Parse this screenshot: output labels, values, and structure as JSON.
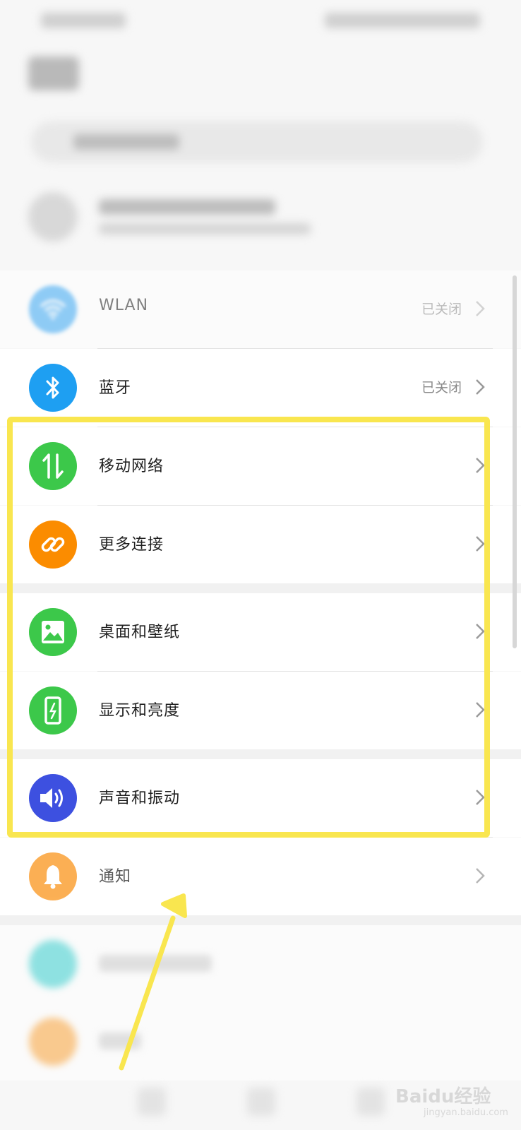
{
  "rows": [
    {
      "label": "WLAN",
      "value": "已关闭",
      "icon": "wifi-icon",
      "color": "#3aa8f5"
    },
    {
      "label": "蓝牙",
      "value": "已关闭",
      "icon": "bluetooth-icon",
      "color": "#1e9ff2"
    },
    {
      "label": "移动网络",
      "value": "",
      "icon": "mobile-data-icon",
      "color": "#3cc84a"
    },
    {
      "label": "更多连接",
      "value": "",
      "icon": "link-icon",
      "color": "#fb8c00"
    },
    {
      "label": "桌面和壁纸",
      "value": "",
      "icon": "image-icon",
      "color": "#3cc84a"
    },
    {
      "label": "显示和亮度",
      "value": "",
      "icon": "display-icon",
      "color": "#3cc84a"
    },
    {
      "label": "声音和振动",
      "value": "",
      "icon": "speaker-icon",
      "color": "#3d50e0"
    },
    {
      "label": "通知",
      "value": "",
      "icon": "bell-icon",
      "color": "#fb8c00"
    }
  ],
  "watermark": {
    "brand": "Baidu经验",
    "url": "jingyan.baidu.com"
  },
  "colors": {
    "highlight": "#f9e64f"
  }
}
